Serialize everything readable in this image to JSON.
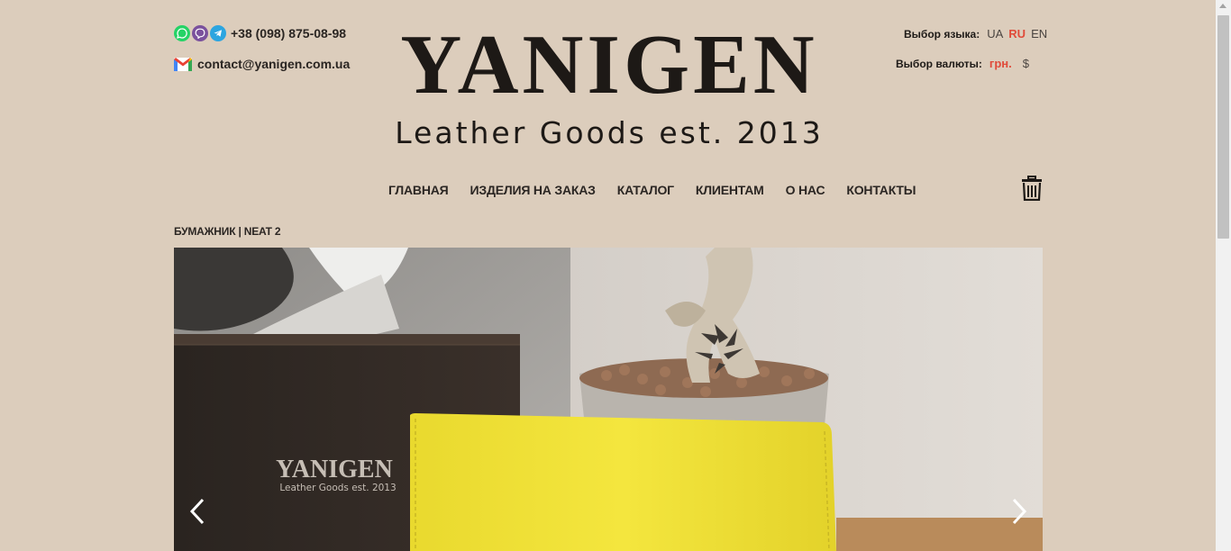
{
  "header": {
    "phone": "+38 (098) 875-08-98",
    "email": "contact@yanigen.com.ua",
    "logo_main": "YANIGEN",
    "logo_sub": "Leather Goods est. 2013",
    "messenger_icons": [
      "whatsapp-icon",
      "viber-icon",
      "telegram-icon"
    ],
    "language": {
      "label": "Выбор языка:",
      "options": [
        "UA",
        "RU",
        "EN"
      ],
      "active": "RU"
    },
    "currency": {
      "label": "Выбор валюты:",
      "options": [
        "грн.",
        "$"
      ],
      "active": "грн."
    }
  },
  "nav": {
    "items": [
      "ГЛАВНАЯ",
      "ИЗДЕЛИЯ НА ЗАКАЗ",
      "КАТАЛОГ",
      "КЛИЕНТАМ",
      "О НАС",
      "КОНТАКТЫ"
    ]
  },
  "cart": {
    "icon": "cart-icon"
  },
  "breadcrumb": "БУМАЖНИК | NEAT 2",
  "gallery": {
    "box_logo_main": "YANIGEN",
    "box_logo_sub": "Leather Goods est. 2013",
    "prev_icon": "chevron-left-icon",
    "next_icon": "chevron-right-icon"
  },
  "colors": {
    "background": "#dccdbc",
    "accent_active": "#e04b3a",
    "text": "#1e1a17",
    "wallet_yellow": "#f2e436"
  }
}
